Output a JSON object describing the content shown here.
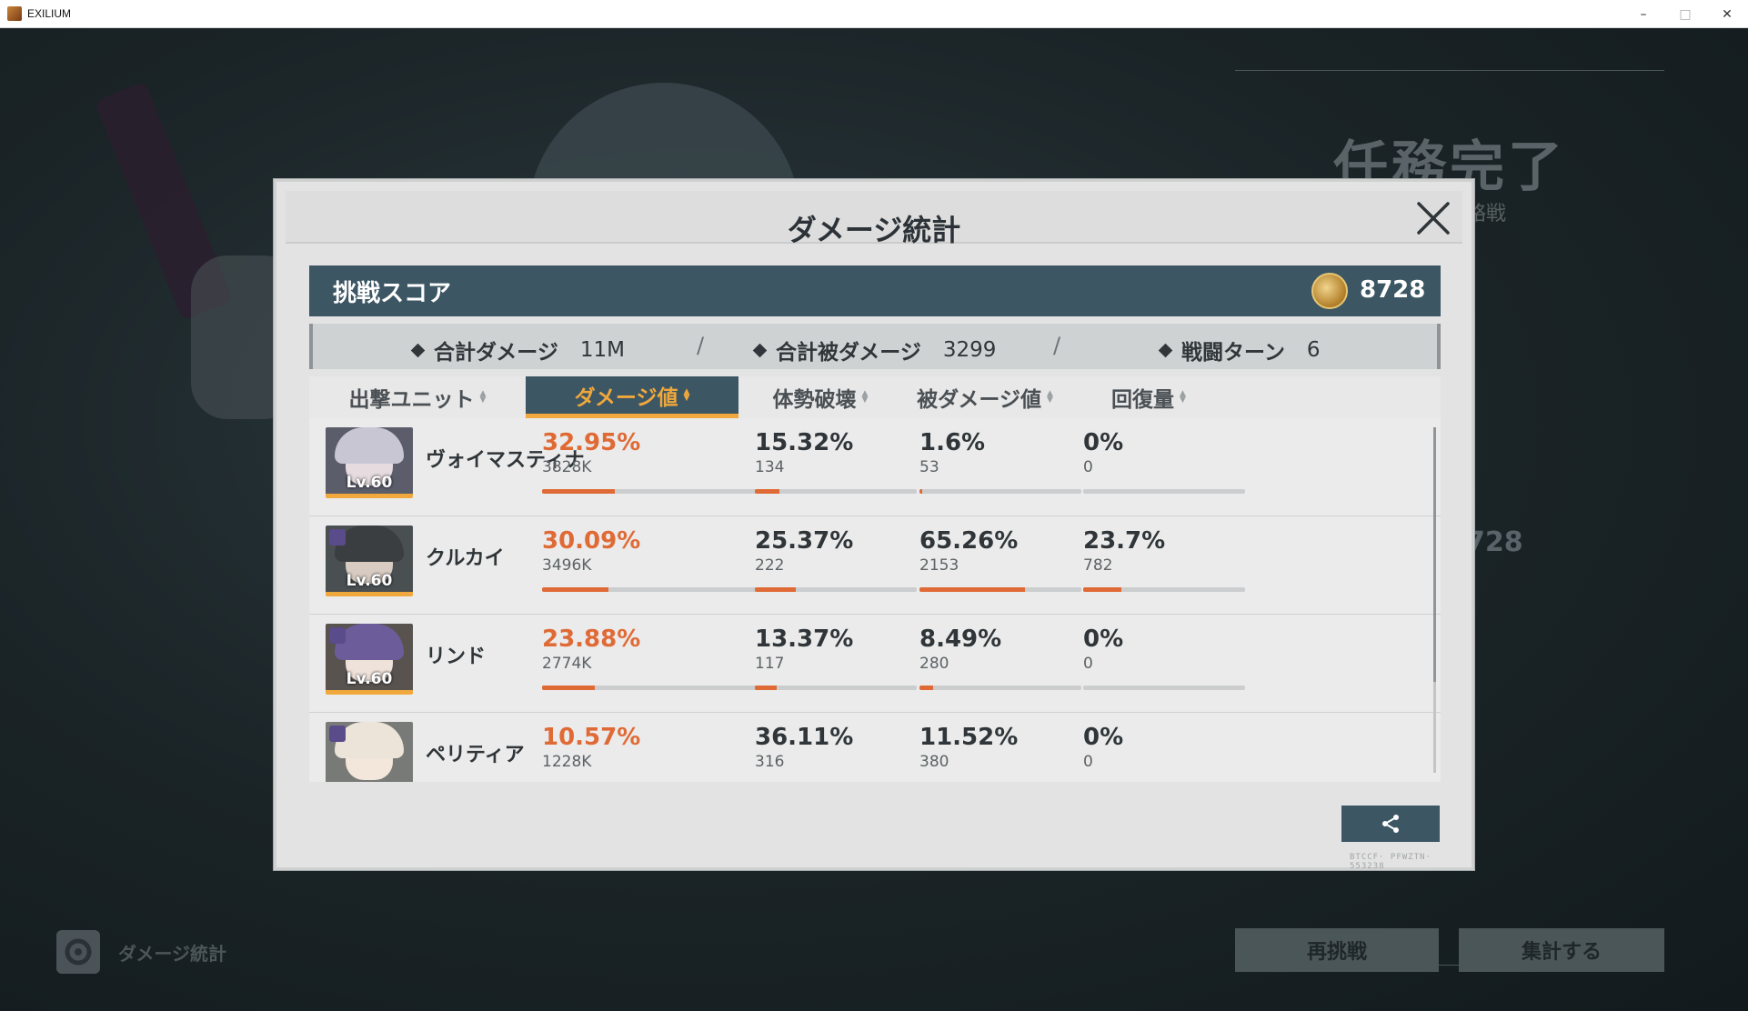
{
  "window": {
    "title": "EXILIUM",
    "minimize": "–",
    "maximize": "□",
    "close": "✕"
  },
  "background": {
    "mission_title": "任務完了",
    "mission_sub": "略戦",
    "score_partial": "728",
    "retry_button": "再挑戦",
    "tally_button": "集計する",
    "damage_stats_label": "ダメージ統計"
  },
  "modal": {
    "title": "ダメージ統計",
    "score": {
      "label": "挑戦スコア",
      "value": "8728"
    },
    "summary": {
      "total_damage_label": "合計ダメージ",
      "total_damage_value": "11M",
      "taken_damage_label": "合計被ダメージ",
      "taken_damage_value": "3299",
      "turns_label": "戦闘ターン",
      "turns_value": "6",
      "separator": "/"
    },
    "columns": [
      "出撃ユニット",
      "ダメージ値",
      "体勢破壊",
      "被ダメージ値",
      "回復量"
    ],
    "active_column": 1,
    "rows": [
      {
        "name": "ヴォイマスティナ",
        "level": "Lv.60",
        "damage_pct": "32.95%",
        "damage_abs": "3828K",
        "damage_frac": 0.3295,
        "break_pct": "15.32%",
        "break_abs": "134",
        "break_frac": 0.1532,
        "taken_pct": "1.6%",
        "taken_abs": "53",
        "taken_frac": 0.016,
        "heal_pct": "0%",
        "heal_abs": "0",
        "heal_frac": 0,
        "hair": "#c9c6d4",
        "face": "#e6dce0",
        "bg": "#5b5d6b"
      },
      {
        "name": "クルカイ",
        "level": "Lv.60",
        "damage_pct": "30.09%",
        "damage_abs": "3496K",
        "damage_frac": 0.3009,
        "break_pct": "25.37%",
        "break_abs": "222",
        "break_frac": 0.2537,
        "taken_pct": "65.26%",
        "taken_abs": "2153",
        "taken_frac": 0.6526,
        "heal_pct": "23.7%",
        "heal_abs": "782",
        "heal_frac": 0.237,
        "hair": "#3b3e41",
        "face": "#d8ccc2",
        "bg": "#4a4f52"
      },
      {
        "name": "リンド",
        "level": "Lv.60",
        "damage_pct": "23.88%",
        "damage_abs": "2774K",
        "damage_frac": 0.2388,
        "break_pct": "13.37%",
        "break_abs": "117",
        "break_frac": 0.1337,
        "taken_pct": "8.49%",
        "taken_abs": "280",
        "taken_frac": 0.0849,
        "heal_pct": "0%",
        "heal_abs": "0",
        "heal_frac": 0,
        "hair": "#6c5d9a",
        "face": "#efe2da",
        "bg": "#58534f"
      },
      {
        "name": "ペリティア",
        "level": "",
        "damage_pct": "10.57%",
        "damage_abs": "1228K",
        "damage_frac": 0.1057,
        "break_pct": "36.11%",
        "break_abs": "316",
        "break_frac": 0.3611,
        "taken_pct": "11.52%",
        "taken_abs": "380",
        "taken_frac": 0.1152,
        "heal_pct": "0%",
        "heal_abs": "0",
        "heal_frac": 0,
        "hair": "#ece4d8",
        "face": "#f3e6da",
        "bg": "#787a78"
      }
    ],
    "footer_tag": "BTCCF· PFWZTN· 553238"
  },
  "colors": {
    "accent": "#f0a83c",
    "header_blue": "#3c5664",
    "damage_orange": "#e06a35"
  }
}
